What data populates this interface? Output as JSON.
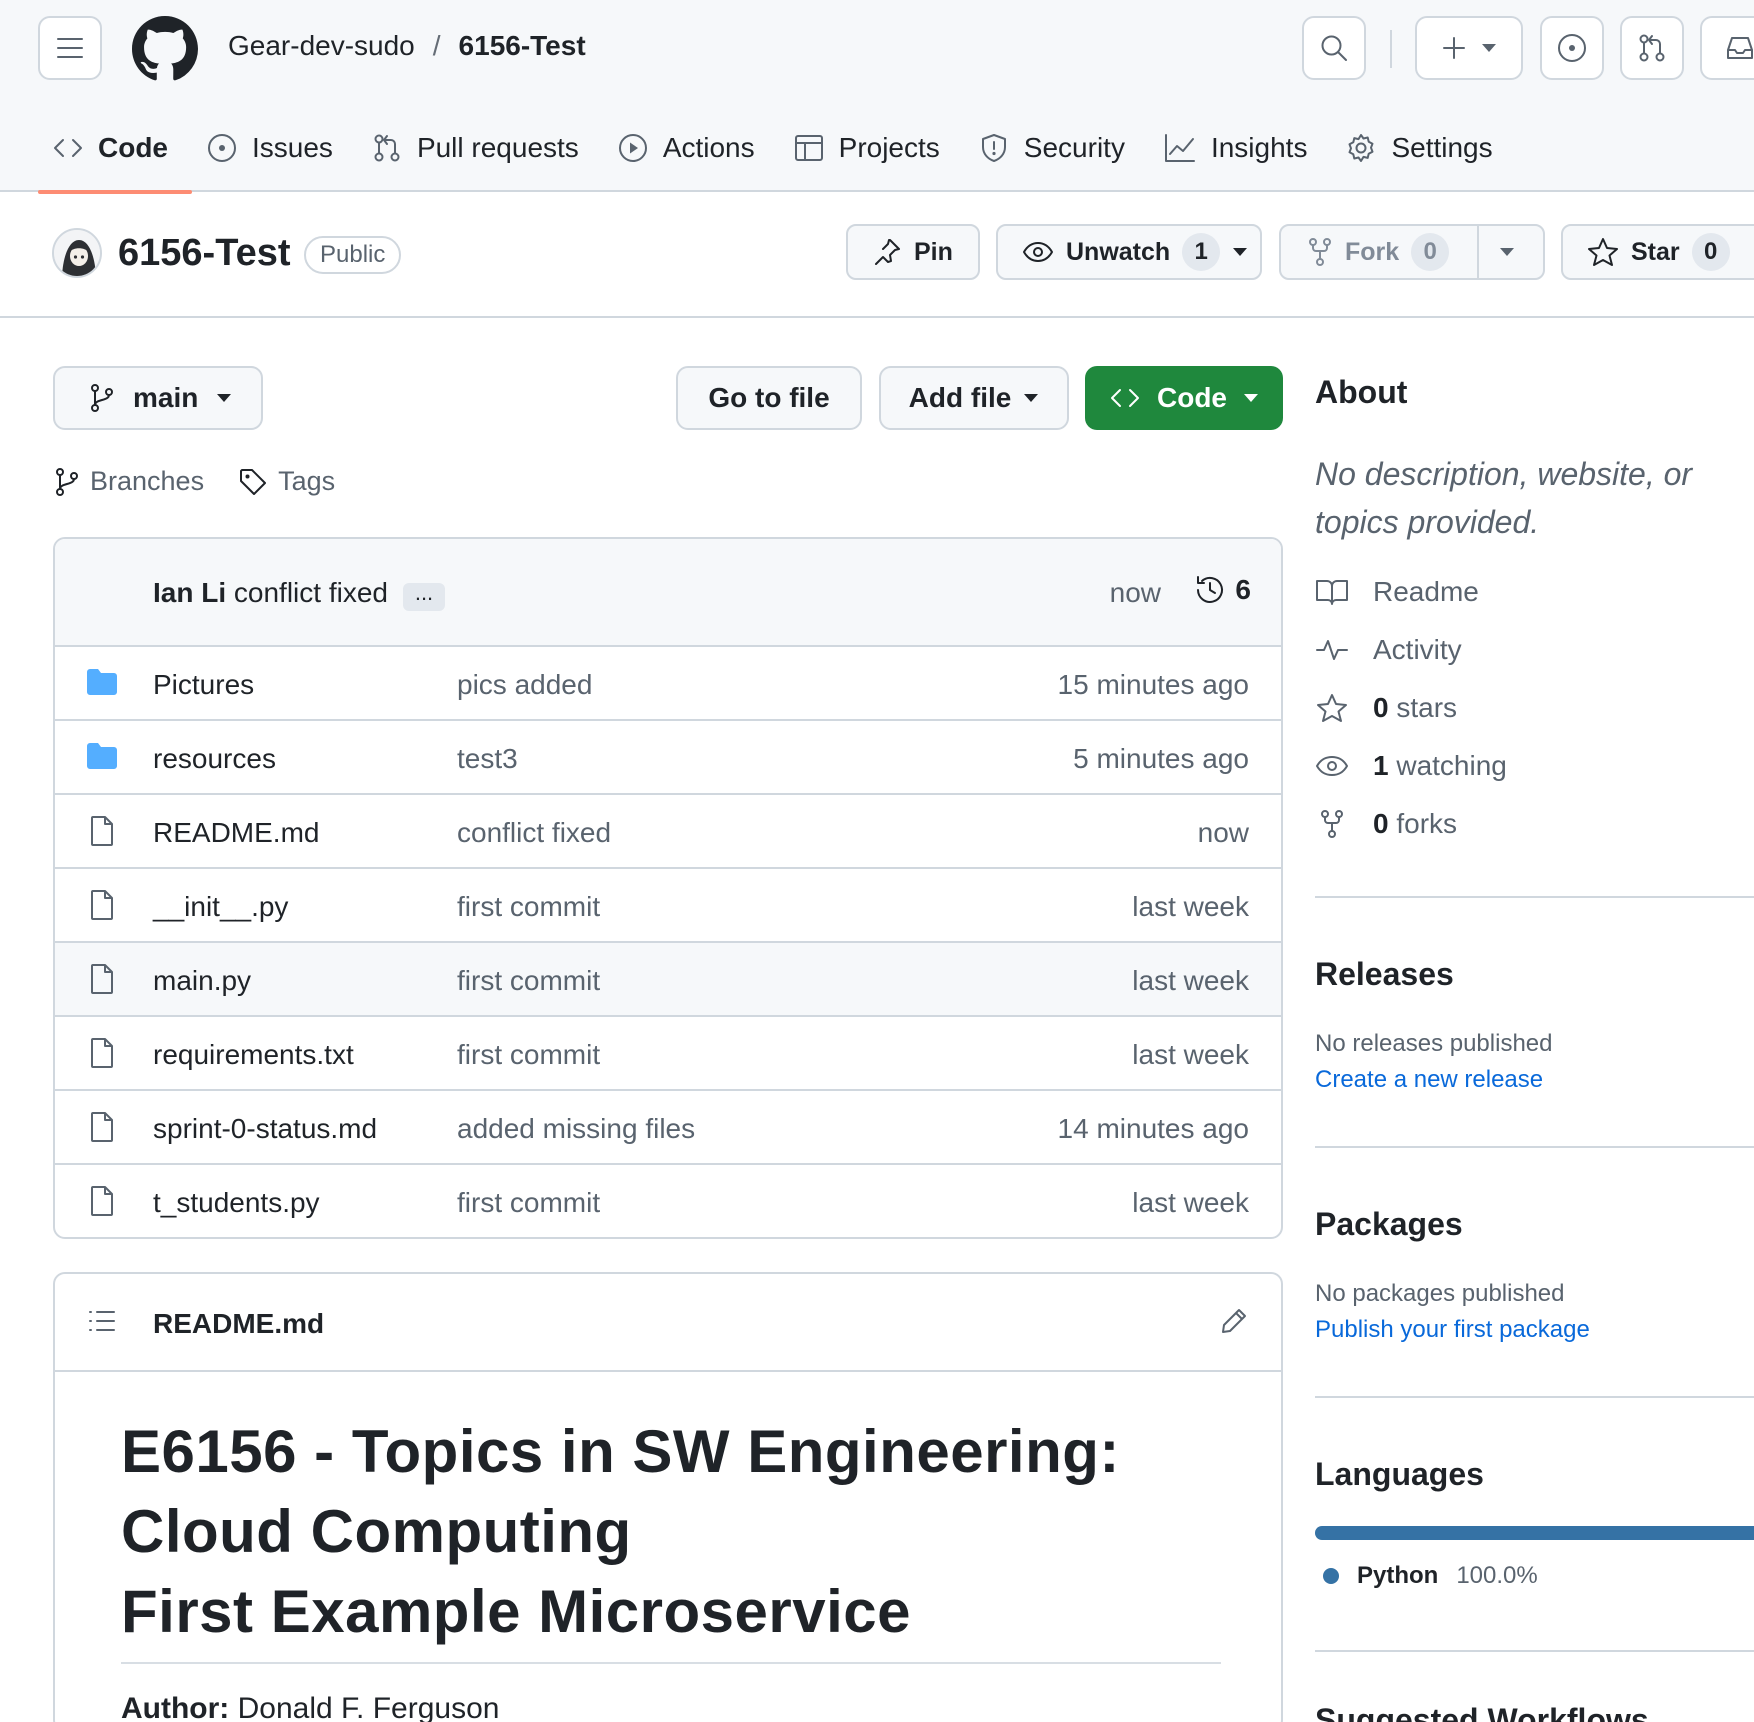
{
  "header": {
    "owner": "Gear-dev-sudo",
    "separator": "/",
    "repo": "6156-Test"
  },
  "tabs": [
    {
      "label": "Code",
      "icon": "code-icon",
      "active": true
    },
    {
      "label": "Issues",
      "icon": "issue-opened-icon"
    },
    {
      "label": "Pull requests",
      "icon": "git-pull-request-icon"
    },
    {
      "label": "Actions",
      "icon": "play-icon"
    },
    {
      "label": "Projects",
      "icon": "table-icon"
    },
    {
      "label": "Security",
      "icon": "shield-icon"
    },
    {
      "label": "Insights",
      "icon": "graph-icon"
    },
    {
      "label": "Settings",
      "icon": "gear-icon"
    }
  ],
  "repo_title": {
    "name": "6156-Test",
    "visibility": "Public",
    "pin_label": "Pin",
    "unwatch_label": "Unwatch",
    "watch_count": "1",
    "fork_label": "Fork",
    "fork_count": "0",
    "star_label": "Star",
    "star_count": "0"
  },
  "toolbar": {
    "branch": "main",
    "go_to_file": "Go to file",
    "add_file": "Add file",
    "code": "Code",
    "branches": "Branches",
    "tags": "Tags"
  },
  "latest_commit": {
    "author": "Ian Li",
    "message": "conflict fixed",
    "ellipsis": "...",
    "time": "now",
    "commit_count": "6"
  },
  "files": [
    {
      "name": "Pictures",
      "type": "dir",
      "message": "pics added",
      "date": "15 minutes ago"
    },
    {
      "name": "resources",
      "type": "dir",
      "message": "test3",
      "date": "5 minutes ago"
    },
    {
      "name": "README.md",
      "type": "file",
      "message": "conflict fixed",
      "date": "now"
    },
    {
      "name": "__init__.py",
      "type": "file",
      "message": "first commit",
      "date": "last week"
    },
    {
      "name": "main.py",
      "type": "file",
      "message": "first commit",
      "date": "last week"
    },
    {
      "name": "requirements.txt",
      "type": "file",
      "message": "first commit",
      "date": "last week"
    },
    {
      "name": "sprint-0-status.md",
      "type": "file",
      "message": "added missing files",
      "date": "14 minutes ago"
    },
    {
      "name": "t_students.py",
      "type": "file",
      "message": "first commit",
      "date": "last week"
    }
  ],
  "readme": {
    "filename": "README.md",
    "heading_line1": "E6156 - Topics in SW Engineering:",
    "heading_line2": "Cloud Computing",
    "heading_line3": "First Example Microservice",
    "author_label": "Author:",
    "author_name": " Donald F. Ferguson"
  },
  "sidebar": {
    "about_title": "About",
    "description": "No description, website, or topics provided.",
    "readme": "Readme",
    "activity": "Activity",
    "stars_count": "0",
    "stars_label": " stars",
    "watching_count": "1",
    "watching_label": " watching",
    "forks_count": "0",
    "forks_label": " forks",
    "releases_title": "Releases",
    "no_releases": "No releases published",
    "create_release": "Create a new release",
    "packages_title": "Packages",
    "no_packages": "No packages published",
    "publish_package": "Publish your first package",
    "languages_title": "Languages",
    "language_name": "Python",
    "language_pct": "100.0%",
    "language_color": "#3572a5",
    "suggested_title": "Suggested Workflows"
  },
  "colors": {
    "accent_green": "#1f883d",
    "link_blue": "#0969da",
    "tab_underline": "#fd8c73",
    "folder_blue": "#54aeff"
  }
}
